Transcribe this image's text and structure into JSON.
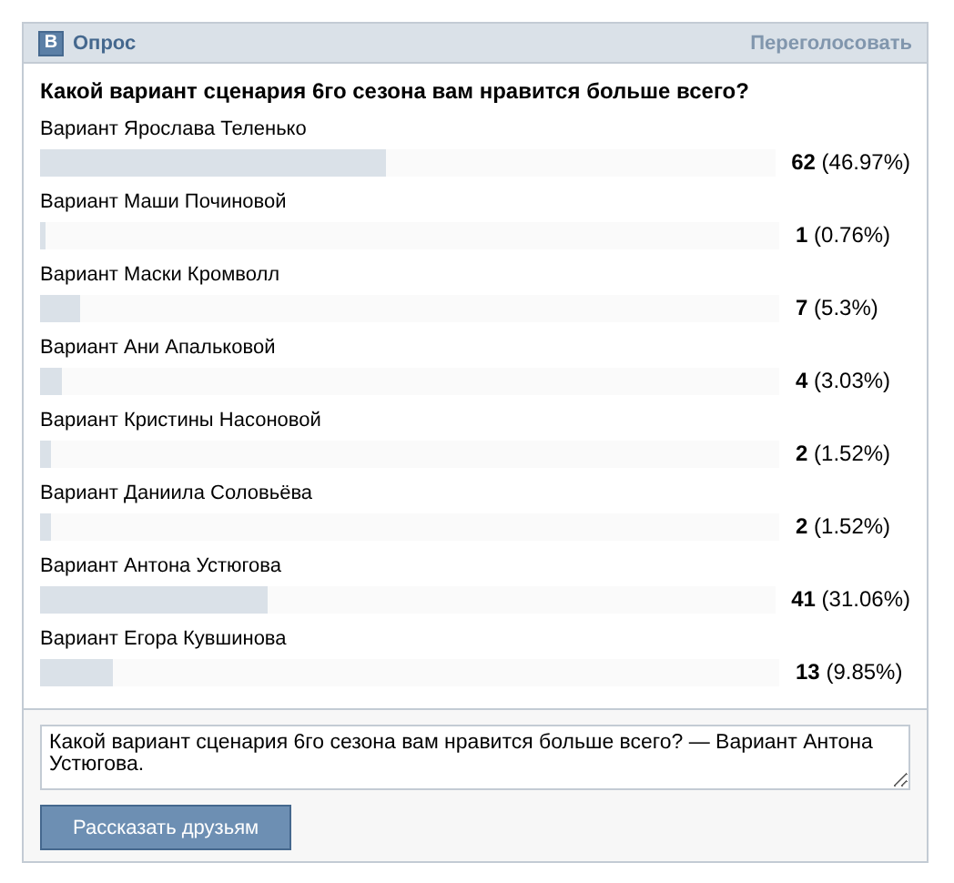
{
  "header": {
    "logo": "В",
    "title": "Опрос",
    "revote": "Переголосовать"
  },
  "question": "Какой вариант сценария 6го сезона вам нравится больше всего?",
  "options": [
    {
      "label": "Вариант Ярослава Теленько",
      "level": 0.4697,
      "count": "62",
      "percent": "(46.97%)"
    },
    {
      "label": "Вариант Маши Починовой",
      "level": 0.0076,
      "count": "1",
      "percent": "(0.76%)"
    },
    {
      "label": "Вариант Маски Кромволл",
      "level": 0.053,
      "count": "7",
      "percent": "(5.3%)"
    },
    {
      "label": "Вариант Ани Апальковой",
      "level": 0.0303,
      "count": "4",
      "percent": "(3.03%)"
    },
    {
      "label": "Вариант Кристины Насоновой",
      "level": 0.0152,
      "count": "2",
      "percent": "(1.52%)"
    },
    {
      "label": "Вариант Даниила Соловьёва",
      "level": 0.0152,
      "count": "2",
      "percent": "(1.52%)"
    },
    {
      "label": "Вариант Антона Устюгова",
      "level": 0.3106,
      "count": "41",
      "percent": "(31.06%)"
    },
    {
      "label": "Вариант Егора Кувшинова",
      "level": 0.0985,
      "count": "13",
      "percent": "(9.85%)"
    }
  ],
  "share": {
    "value": "Какой вариант сценария 6го сезона вам нравится больше всего? — Вариант Антона Устюгова.",
    "button": "Рассказать друзьям"
  }
}
